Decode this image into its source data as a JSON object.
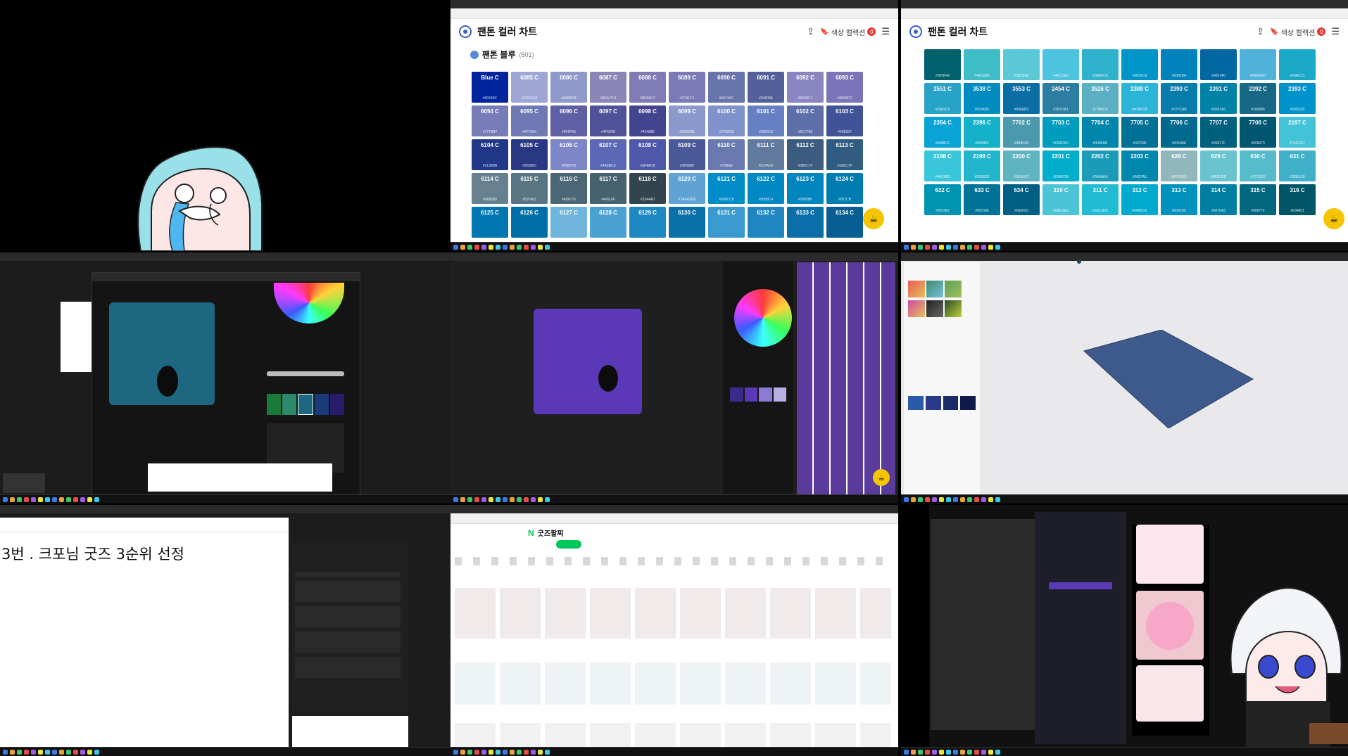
{
  "pantone_a": {
    "title": "팬톤 컬러 차트",
    "collection_label": "색상 컬렉션",
    "collection_count": "0",
    "section_title": "팬톤 블루",
    "section_count": "(501)",
    "swatches": [
      {
        "name": "Blue C",
        "hex": "#00249C",
        "color": "#00249c"
      },
      {
        "name": "6085 C",
        "hex": "#C8CEEA",
        "color": "#9ea6d6"
      },
      {
        "name": "6086 C",
        "hex": "#A8B5D8",
        "color": "#8f99cb"
      },
      {
        "name": "6087 C",
        "hex": "#9EA7CD",
        "color": "#8a87b8"
      },
      {
        "name": "6088 C",
        "hex": "#8E8AC2",
        "color": "#7f7bb4"
      },
      {
        "name": "6089 C",
        "hex": "#7C81C1",
        "color": "#7b7ab7"
      },
      {
        "name": "6090 C",
        "hex": "#6874AC",
        "color": "#6874ac"
      },
      {
        "name": "6091 C",
        "hex": "#54609A",
        "color": "#54609a"
      },
      {
        "name": "6092 C",
        "hex": "#8C89C7",
        "color": "#8a86c2"
      },
      {
        "name": "6093 C",
        "hex": "#6B68C2",
        "color": "#7c74b8"
      },
      {
        "name": "6094 C",
        "hex": "#777BB7",
        "color": "#777bb7"
      },
      {
        "name": "6095 C",
        "hex": "#6F7284",
        "color": "#6f7ab4"
      },
      {
        "name": "6096 C",
        "hex": "#5F5FA5",
        "color": "#5f5fa5"
      },
      {
        "name": "6097 C",
        "hex": "#4F5298",
        "color": "#4f5298"
      },
      {
        "name": "6098 C",
        "hex": "#42458E",
        "color": "#42458e"
      },
      {
        "name": "6099 C",
        "hex": "#90A5DB",
        "color": "#8a9acc"
      },
      {
        "name": "6100 C",
        "hex": "#7F92CB",
        "color": "#7f92cb"
      },
      {
        "name": "6101 C",
        "hex": "#6680C3",
        "color": "#6680c3"
      },
      {
        "name": "6102 C",
        "hex": "#5C7786",
        "color": "#5c6fa8"
      },
      {
        "name": "6103 C",
        "hex": "#405397",
        "color": "#405397"
      },
      {
        "name": "6104 C",
        "hex": "#2138BB",
        "color": "#213888"
      },
      {
        "name": "6105 C",
        "hex": "#283883",
        "color": "#283883"
      },
      {
        "name": "6106 C",
        "hex": "#858FD5",
        "color": "#7d87c8"
      },
      {
        "name": "6107 C",
        "hex": "#4A5BCE",
        "color": "#5a68b5"
      },
      {
        "name": "6108 C",
        "hex": "#3F4AC8",
        "color": "#4f58a8"
      },
      {
        "name": "6109 C",
        "hex": "#3F5080",
        "color": "#4a5a98"
      },
      {
        "name": "6110 C",
        "hex": "#758AB",
        "color": "#6a7ab0"
      },
      {
        "name": "6111 C",
        "hex": "#627A9D",
        "color": "#627a9d"
      },
      {
        "name": "6112 C",
        "hex": "#3B5C7F",
        "color": "#3b5c7f"
      },
      {
        "name": "6113 C",
        "hex": "#2A5C7F",
        "color": "#2f5c80"
      },
      {
        "name": "6114 C",
        "hex": "#668090",
        "color": "#668090"
      },
      {
        "name": "6115 C",
        "hex": "#597482",
        "color": "#597482"
      },
      {
        "name": "6116 C",
        "hex": "#4B6775",
        "color": "#4b6775"
      },
      {
        "name": "6117 C",
        "hex": "#46616F",
        "color": "#46616f"
      },
      {
        "name": "6118 C",
        "hex": "#32444D",
        "color": "#32444d"
      },
      {
        "name": "6120 C",
        "hex": "#7AAA3DE",
        "color": "#5fa3d4"
      },
      {
        "name": "6121 C",
        "hex": "#008CC8",
        "color": "#008cc8"
      },
      {
        "name": "6122 C",
        "hex": "#0088C4",
        "color": "#0088c4"
      },
      {
        "name": "6123 C",
        "hex": "#0085BF",
        "color": "#0085bf"
      },
      {
        "name": "6124 C",
        "hex": "#007CB",
        "color": "#007cb0"
      },
      {
        "name": "6125 C",
        "hex": "",
        "color": "#0077b0"
      },
      {
        "name": "6126 C",
        "hex": "",
        "color": "#006fa6"
      },
      {
        "name": "6127 C",
        "hex": "",
        "color": "#6fb5dc"
      },
      {
        "name": "6128 C",
        "hex": "",
        "color": "#4aa1d2"
      },
      {
        "name": "6129 C",
        "hex": "",
        "color": "#1e88c2"
      },
      {
        "name": "6130 C",
        "hex": "",
        "color": "#0a70a8"
      },
      {
        "name": "6131 C",
        "hex": "",
        "color": "#3a9ad0"
      },
      {
        "name": "6132 C",
        "hex": "",
        "color": "#1f86c0"
      },
      {
        "name": "6133 C",
        "hex": "",
        "color": "#0a6fa8"
      },
      {
        "name": "6134 C",
        "hex": "",
        "color": "#085e92"
      }
    ]
  },
  "pantone_b": {
    "title": "팬톤 컬러 차트",
    "collection_label": "색상 컬렉션",
    "collection_count": "0",
    "swatches": [
      {
        "name": "",
        "hex": "#005B49",
        "color": "#00606c"
      },
      {
        "name": "",
        "hex": "#4AC8B8",
        "color": "#3fbdc6"
      },
      {
        "name": "",
        "hex": "#5BD3E0",
        "color": "#5ac8d6"
      },
      {
        "name": "",
        "hex": "#4EC3E0",
        "color": "#4ec3e0"
      },
      {
        "name": "",
        "hex": "#3AB5C8",
        "color": "#2fb3cc"
      },
      {
        "name": "",
        "hex": "#0095C8",
        "color": "#0095c8"
      },
      {
        "name": "",
        "hex": "#0082BA",
        "color": "#0082ba"
      },
      {
        "name": "",
        "hex": "#0067A0",
        "color": "#0067a0"
      },
      {
        "name": "",
        "hex": "#6BBADD",
        "color": "#4fb2d8"
      },
      {
        "name": "",
        "hex": "#00ACC1",
        "color": "#1aa8c8"
      },
      {
        "name": "2551 C",
        "hex": "#28A3C0",
        "color": "#28a3c8"
      },
      {
        "name": "3538 C",
        "hex": "#0094D5",
        "color": "#008cc0"
      },
      {
        "name": "3553 C",
        "hex": "#006EB3",
        "color": "#0a6ea4"
      },
      {
        "name": "2454 C",
        "hex": "#2B7DA1",
        "color": "#2b7da1"
      },
      {
        "name": "3526 C",
        "hex": "#73B5C4",
        "color": "#5cb0c4"
      },
      {
        "name": "2389 C",
        "hex": "#4CBFDB",
        "color": "#2ab4d8"
      },
      {
        "name": "2390 C",
        "hex": "#077CAB",
        "color": "#077cab"
      },
      {
        "name": "2391 C",
        "hex": "#0081A6",
        "color": "#0081a6"
      },
      {
        "name": "2392 C",
        "hex": "#166886",
        "color": "#166886"
      },
      {
        "name": "2393 C",
        "hex": "#0092CB",
        "color": "#0092cb"
      },
      {
        "name": "2394 C",
        "hex": "#0088CE",
        "color": "#0aa3d6"
      },
      {
        "name": "2396 C",
        "hex": "#009982",
        "color": "#13b0c8"
      },
      {
        "name": "7702 C",
        "hex": "#4B8FA5",
        "color": "#4a99ac"
      },
      {
        "name": "7703 C",
        "hex": "#009CBD",
        "color": "#009cbd"
      },
      {
        "name": "7704 C",
        "hex": "#0085AD",
        "color": "#0085ad"
      },
      {
        "name": "7705 C",
        "hex": "#007096",
        "color": "#007096"
      },
      {
        "name": "7706 C",
        "hex": "#006A8E",
        "color": "#006a8e"
      },
      {
        "name": "7707 C",
        "hex": "#00617F",
        "color": "#00617f"
      },
      {
        "name": "7708 C",
        "hex": "#005670",
        "color": "#005670"
      },
      {
        "name": "2197 C",
        "hex": "#7ADCE7",
        "color": "#43c3d6"
      },
      {
        "name": "2198 C",
        "hex": "#4AC9E3",
        "color": "#3ac6da"
      },
      {
        "name": "2199 C",
        "hex": "#00B6D0",
        "color": "#22b6cc"
      },
      {
        "name": "2200 C",
        "hex": "#3E9A9C",
        "color": "#5eb4c0"
      },
      {
        "name": "2201 C",
        "hex": "#00AEDB",
        "color": "#00aecc"
      },
      {
        "name": "2202 C",
        "hex": "#0A9ABA",
        "color": "#1a9cb8"
      },
      {
        "name": "2203 C",
        "hex": "#0087AE",
        "color": "#0087ae"
      },
      {
        "name": "628 C",
        "hex": "#B7DDE1",
        "color": "#8fb7bc"
      },
      {
        "name": "629 C",
        "hex": "#9BD3DD",
        "color": "#6ac4d0"
      },
      {
        "name": "630 C",
        "hex": "#77C5D5",
        "color": "#56bccc"
      },
      {
        "name": "631 C",
        "hex": "#3EB1C8",
        "color": "#3eb1c8"
      },
      {
        "name": "632 C",
        "hex": "#0093B2",
        "color": "#0093b2"
      },
      {
        "name": "633 C",
        "hex": "#007396",
        "color": "#007396"
      },
      {
        "name": "634 C",
        "hex": "#005F83",
        "color": "#005f83"
      },
      {
        "name": "310 C",
        "hex": "#6AD1E3",
        "color": "#4cc4d8"
      },
      {
        "name": "311 C",
        "hex": "#05C3DD",
        "color": "#21bcd4"
      },
      {
        "name": "312 C",
        "hex": "#00A9CE",
        "color": "#00a9ce"
      },
      {
        "name": "313 C",
        "hex": "#0092BC",
        "color": "#0092bc"
      },
      {
        "name": "314 C",
        "hex": "#007FA3",
        "color": "#007fa3"
      },
      {
        "name": "315 C",
        "hex": "#00677F",
        "color": "#00677f"
      },
      {
        "name": "316 C",
        "hex": "#004851",
        "color": "#005566"
      }
    ]
  },
  "t7": {
    "caption": "3번 . 크포님 굿즈 3순위 선정"
  },
  "t8": {
    "search_text": "굿즈팔찌"
  },
  "colors": {
    "pantone_blue": "#5a8ad6",
    "fab_yellow": "#f6c400",
    "naver_green": "#03c75a"
  }
}
